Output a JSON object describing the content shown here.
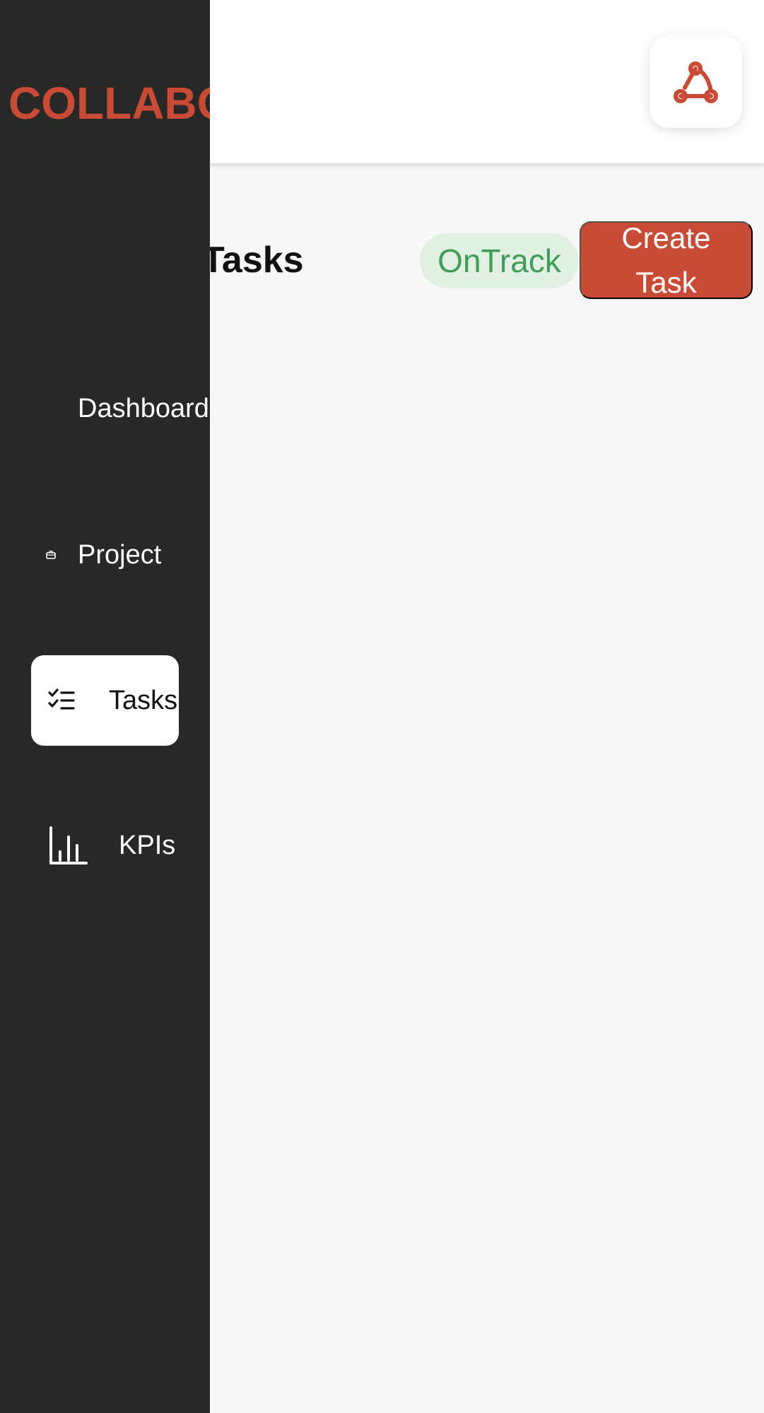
{
  "app": {
    "brand": "COLLABO",
    "accent_color": "#c94a35"
  },
  "header": {
    "webhook_icon": "webhook-icon"
  },
  "main": {
    "title": "Tasks",
    "status": "OnTrack",
    "create_button_label": "Create Task"
  },
  "sidebar": {
    "items": [
      {
        "label": "Dashboard",
        "icon": ""
      },
      {
        "label": "Project",
        "icon": "briefcase-icon"
      },
      {
        "label": "Tasks",
        "icon": "checklist-icon",
        "active": true
      },
      {
        "label": "KPIs",
        "icon": "bar-chart-icon"
      }
    ]
  }
}
